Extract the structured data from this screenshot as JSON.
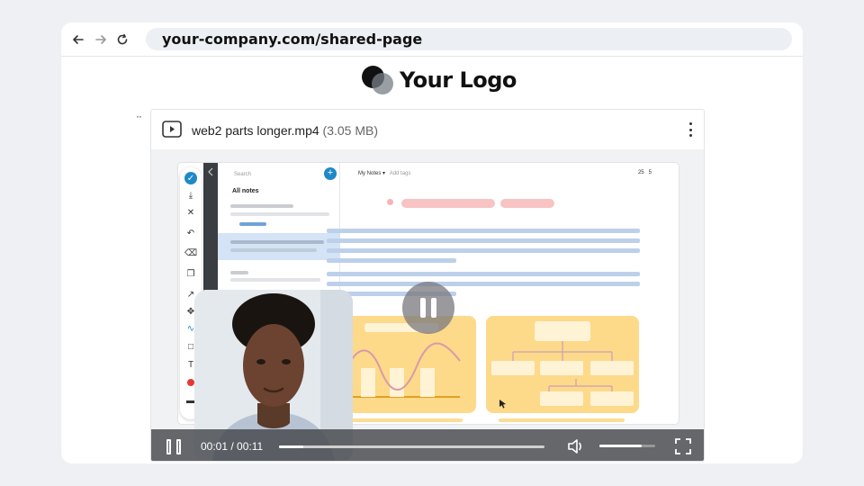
{
  "browser": {
    "url": "your-company.com/shared-page",
    "icons": [
      "back-arrow-icon",
      "forward-arrow-icon",
      "reload-icon"
    ]
  },
  "logo": {
    "text": "Your Logo"
  },
  "file": {
    "name": "web2 parts longer.mp4",
    "size": "(3.05 MB)",
    "icon": "video-file-icon"
  },
  "app_mock": {
    "search_placeholder": "Search",
    "list_title": "All notes",
    "folder": "My Notes",
    "tag_action": "Add tags",
    "word_count": "25",
    "page_count": "5"
  },
  "player": {
    "current_time": "00:01",
    "separator": " / ",
    "duration": "00:11",
    "progress": 0.09,
    "volume": 0.75,
    "colors": {
      "control_bg": "#46484c",
      "accent_yellow": "#fdd98a",
      "accent_blue": "#1e88c8"
    }
  }
}
